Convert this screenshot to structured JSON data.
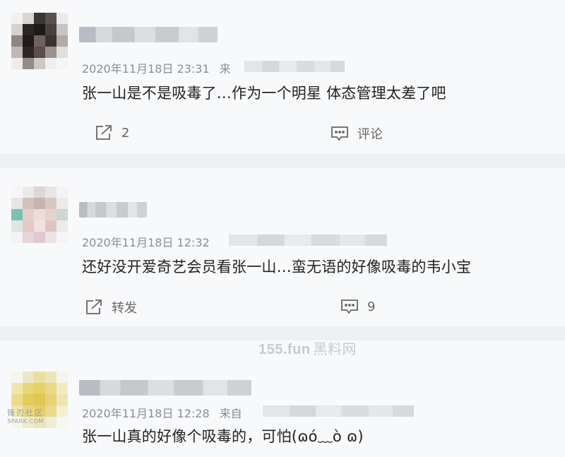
{
  "posts": [
    {
      "timestamp": "2020年11月18日 23:31",
      "source_prefix": "来",
      "content": "张一山是不是吸毒了…作为一个明星 体态管理太差了吧",
      "left_action": {
        "icon": "share-icon",
        "label": "2"
      },
      "right_action": {
        "icon": "comment-icon",
        "label": "评论"
      }
    },
    {
      "timestamp": "2020年11月18日 12:32",
      "source_prefix": "",
      "content": "还好没开爱奇艺会员看张一山…蛮无语的好像吸毒的韦小宝",
      "left_action": {
        "icon": "share-icon",
        "label": "转发"
      },
      "right_action": {
        "icon": "comment-icon",
        "label": "9"
      }
    },
    {
      "timestamp": "2020年11月18日 12:28",
      "source_prefix": "来自",
      "content": "张一山真的好像个吸毒的，可怕(ɷó﹏ò ɷ)"
    }
  ],
  "watermark": {
    "brand": "155.fun",
    "name": "黑料网"
  },
  "corner_logo": {
    "line1": "锋刃社区",
    "line2": "5PARK.COM"
  },
  "colors": {
    "card_bg": "#f8f9fb",
    "page_bg": "#eef0f3",
    "text": "#222222",
    "meta": "#8a8d92",
    "icon": "#666666"
  }
}
